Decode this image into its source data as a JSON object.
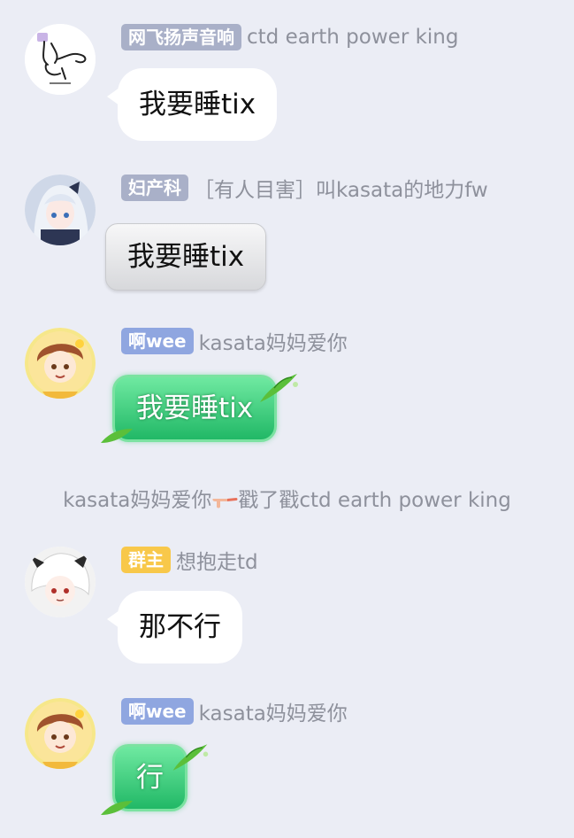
{
  "colors": {
    "background": "#ebedf5",
    "badge_blue_gray": "#a9b0c8",
    "badge_blue": "#8fa6e0",
    "badge_owner": "#f8c84a",
    "name_gray": "#8e919c",
    "bubble_green": "#34c977"
  },
  "messages": [
    {
      "badge": "网飞扬声音响",
      "sender": "ctd earth power king",
      "text": "我要睡tix",
      "avatar_icon": "sketch-avatar-icon",
      "bubble_style": "white"
    },
    {
      "badge": "妇产科",
      "sender": "［有人目害］叫kasata的地力fw",
      "text": "我要睡tix",
      "avatar_icon": "anime-girl-avatar-icon",
      "bubble_style": "gray"
    },
    {
      "badge": "啊wee",
      "sender": "kasata妈妈爱你",
      "text": "我要睡tix",
      "avatar_icon": "anime-boy-avatar-icon",
      "bubble_style": "green"
    },
    {
      "badge": "群主",
      "sender": "想抱走td",
      "text": "那不行",
      "avatar_icon": "white-hair-avatar-icon",
      "bubble_style": "white"
    },
    {
      "badge": "啊wee",
      "sender": "kasata妈妈爱你",
      "text": "行",
      "avatar_icon": "anime-boy-avatar-icon",
      "bubble_style": "green"
    }
  ],
  "system_notice": {
    "actor": "kasata妈妈爱你",
    "icon": "poke-hand-icon",
    "action": "戳了戳ctd earth power king"
  }
}
